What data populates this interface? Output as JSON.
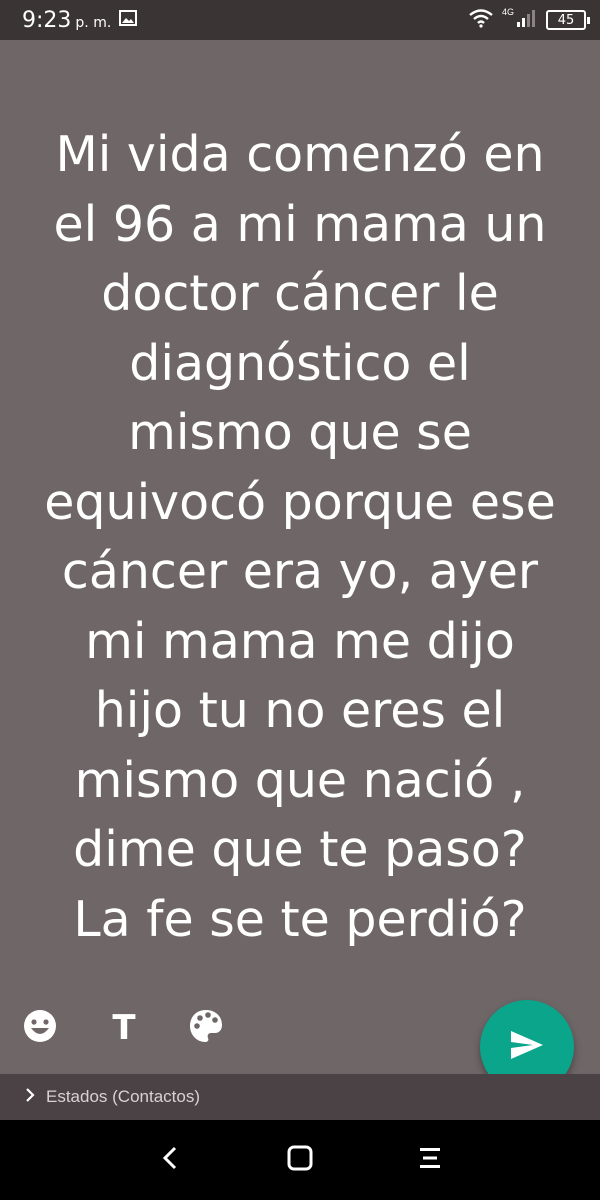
{
  "status_bar": {
    "time": "9:23",
    "ampm": "p. m.",
    "network": "4G",
    "battery": "45"
  },
  "status_text": "Mi vida comenzó en\nel 96 a mi mama un\ndoctor cáncer le\ndiagnóstico el\nmismo que se\nequivocó porque ese\ncáncer era yo, ayer\nmi mama me dijo\nhijo tu no eres el\nmismo que nació ,\ndime que te paso?\nLa fe se te perdió? ",
  "tools": {
    "emoji_icon": "smiley-icon",
    "text_label": "T",
    "color_icon": "palette-icon"
  },
  "send_button": {
    "icon": "send-icon",
    "color": "#0aa58a"
  },
  "audience": {
    "label": "Estados (Contactos)"
  },
  "colors": {
    "background": "#6f6668",
    "status_bar": "#3a3435",
    "audience_bar": "#4a4244"
  }
}
